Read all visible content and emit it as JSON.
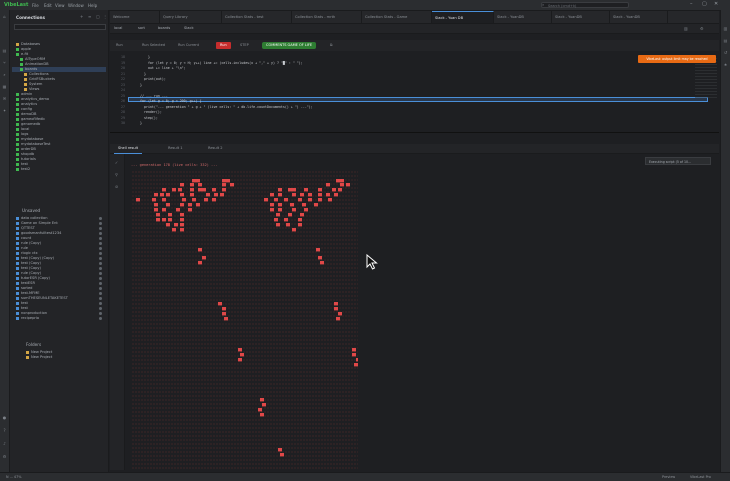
{
  "app": {
    "title": "VibeLast"
  },
  "menu": [
    "File",
    "Edit",
    "View",
    "Window",
    "Help"
  ],
  "search": {
    "placeholder": "Search (cmd+k)"
  },
  "sidebar": {
    "title": "Connections",
    "tree": [
      {
        "label": "Databases",
        "icon": "folder-icon",
        "selected": false
      },
      {
        "label": "apple",
        "icon": "db-icon"
      },
      {
        "label": "e-fit",
        "icon": "db-icon"
      },
      {
        "label": "AITypeORM",
        "icon": "db-icon"
      },
      {
        "label": "AnimationDB",
        "icon": "db-icon"
      },
      {
        "label": "boards",
        "icon": "db-icon",
        "selected": true
      },
      {
        "label": "Collections",
        "icon": "folder-icon"
      },
      {
        "label": "GridFSBuckets",
        "icon": "folder-icon"
      },
      {
        "label": "System",
        "icon": "folder-icon"
      },
      {
        "label": "Views",
        "icon": "folder-icon"
      },
      {
        "label": "admin",
        "icon": "db-icon"
      },
      {
        "label": "analytics_demo",
        "icon": "db-icon"
      },
      {
        "label": "analytics",
        "icon": "db-icon"
      },
      {
        "label": "config",
        "icon": "db-icon"
      },
      {
        "label": "demoDB",
        "icon": "db-icon"
      },
      {
        "label": "gameoflifedb",
        "icon": "db-icon"
      },
      {
        "label": "genomedb",
        "icon": "db-icon"
      },
      {
        "label": "local",
        "icon": "db-icon"
      },
      {
        "label": "logs",
        "icon": "db-icon"
      },
      {
        "label": "mydatabase",
        "icon": "db-icon"
      },
      {
        "label": "mydatabaseTest",
        "icon": "db-icon"
      },
      {
        "label": "orderDB",
        "icon": "db-icon"
      },
      {
        "label": "shopdb",
        "icon": "db-icon"
      },
      {
        "label": "tutorials",
        "icon": "db-icon"
      },
      {
        "label": "test",
        "icon": "db-icon"
      },
      {
        "label": "test2",
        "icon": "db-icon"
      }
    ],
    "section2_title": "Unsaved",
    "scripts": [
      "data collection",
      "Game on Simple Ent",
      "QTTEST",
      "goodsmanfulltest1234",
      "count",
      "rule (Copy)",
      "rule",
      "rlogic ctx",
      "test (Copy) (Copy)",
      "test (Copy)",
      "test (Copy)",
      "rule (Copy)",
      "tutorESR (Copy)",
      "testESR",
      "sorted",
      "test.MFME",
      "sumTHESEUNLETAKETEST",
      "test",
      "test",
      "nonproduction",
      "recipeprio"
    ],
    "section3_title": "Folders",
    "folders": [
      "New Project",
      "New Project"
    ]
  },
  "tabs": [
    {
      "label": "Welcome",
      "active": false
    },
    {
      "label": "Query Library",
      "active": false
    },
    {
      "label": "Collection Stats - test",
      "active": false
    },
    {
      "label": "Collection Stats - mrth",
      "active": false
    },
    {
      "label": "Collection Stats - Game",
      "active": false
    },
    {
      "label": "Slack - Yuan DB",
      "active": true
    },
    {
      "label": "Slack - YuanDB",
      "active": false
    },
    {
      "label": "Slack - YuanDB",
      "active": false
    },
    {
      "label": "Slack - YuanDB",
      "active": false
    }
  ],
  "crumbs": [
    "local",
    "sort",
    "boards",
    "Slack"
  ],
  "toolbar": {
    "items": [
      "Run",
      "Run Selected",
      "Run Current",
      "Run",
      "STEP"
    ],
    "mode_label": "COMMENTS GAME OF LIFE"
  },
  "editor": {
    "lines": [
      {
        "no": "18",
        "code": "    }"
      },
      {
        "no": "19",
        "code": "    for (let y = 0; y < H; y++) line += (cells.includes(x + \",\" + y) ? \"█\" : \" \");"
      },
      {
        "no": "20",
        "code": "    out += line + \"\\n\";"
      },
      {
        "no": "21",
        "code": "  }"
      },
      {
        "no": "22",
        "code": "  print(out);"
      },
      {
        "no": "23",
        "code": "}"
      },
      {
        "no": "24",
        "code": ""
      },
      {
        "no": "25",
        "code": "// --- run ---"
      },
      {
        "no": "26",
        "code": "for (let g = 0; g < 200; g++) {"
      },
      {
        "no": "27",
        "code": "  print(\"--- generation \" + g + \" (live cells: \" + db.life.countDocuments() + \") ---\");"
      },
      {
        "no": "28",
        "code": "  render();"
      },
      {
        "no": "29",
        "code": "  step();"
      },
      {
        "no": "30",
        "code": "}"
      }
    ],
    "warning": "VibeLast: output limit may be reached"
  },
  "results": {
    "tabs": [
      {
        "label": "Shell result",
        "active": true
      },
      {
        "label": "Result 1",
        "active": false
      },
      {
        "label": "Result 2",
        "active": false
      }
    ],
    "exec_note": "Executing script (5 of 10...",
    "generation_line": "--- generation 178 (live cells: 332) ---"
  },
  "status": {
    "left": "N ... 47%",
    "right1": "Preview",
    "right2": "VibeLast Pro"
  },
  "colors": {
    "accent": "#4a8fd9",
    "run": "#c62d2d",
    "cell": "#e04848",
    "warning": "#e86a14"
  }
}
